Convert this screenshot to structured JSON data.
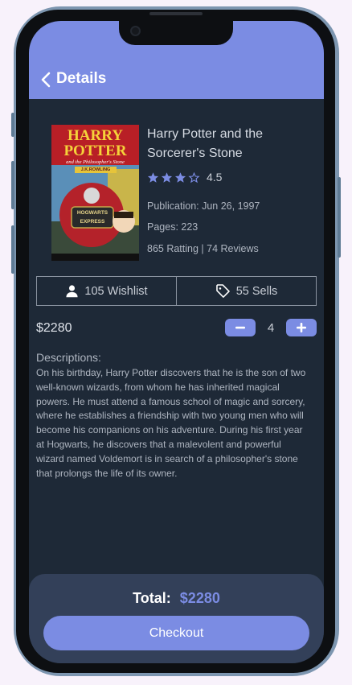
{
  "header": {
    "title": "Details",
    "back_icon": "chevron-left-icon"
  },
  "book": {
    "title": "Harry Potter and the Sorcerer's Stone",
    "rating": 4.5,
    "rating_text": "4.5",
    "stars_filled": 3,
    "stars_total": 4,
    "publication": "Publication: Jun 26, 1997",
    "pages": "Pages: 223",
    "ratings_reviews": "865 Ratting | 74 Reviews",
    "cover": {
      "title_line1": "HARRY",
      "title_line2": "POTTER",
      "subtitle": "and the Philosopher's Stone",
      "author": "J.K.ROWLING",
      "train_label": "HOGWARTS EXPRESS"
    }
  },
  "stats": {
    "wishlist": "105 Wishlist",
    "wishlist_icon": "user-icon",
    "sells": "55 Sells",
    "sells_icon": "tag-icon"
  },
  "price": "$2280",
  "quantity": "4",
  "stepper": {
    "minus_icon": "minus-icon",
    "plus_icon": "plus-icon"
  },
  "description": {
    "label": "Descriptions:",
    "text": "On his birthday, Harry Potter discovers that he is the son of two well-known wizards, from whom he has inherited magical powers. He must attend a famous school of magic and sorcery, where he establishes a friendship with two young men who will become his companions on his adventure. During his first year at Hogwarts, he discovers that a malevolent and powerful wizard named Voldemort is in search of a philosopher's stone that prolongs the life of its owner."
  },
  "footer": {
    "total_label": "Total:",
    "total_value": "$2280",
    "checkout_label": "Checkout"
  },
  "colors": {
    "accent": "#7b8ce3",
    "background": "#1e2937",
    "footer": "#334059"
  }
}
